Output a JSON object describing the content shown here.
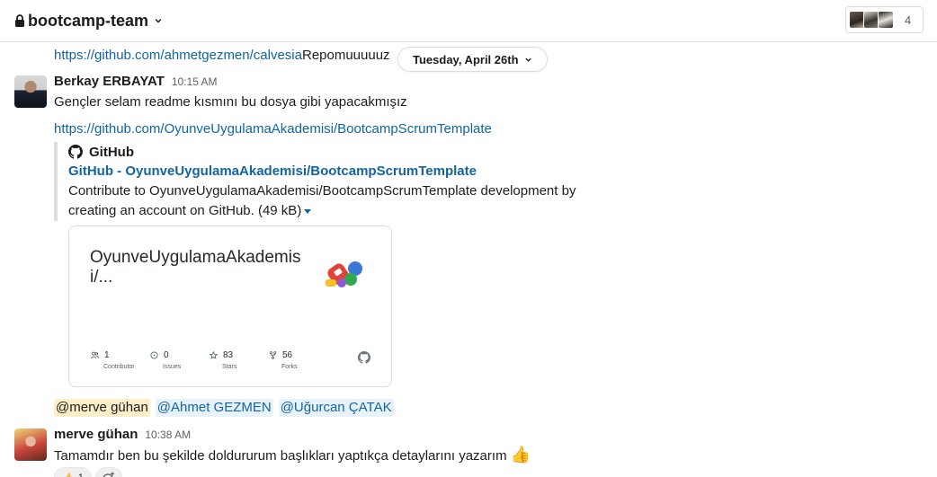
{
  "header": {
    "channel_name": "bootcamp-team",
    "member_count": "4"
  },
  "top": {
    "link": "https://github.com/ahmetgezmen/calvesia",
    "text": " Repomuuuuuz",
    "date_pill": "Tuesday, April 26th"
  },
  "message1": {
    "author": "Berkay ERBAYAT",
    "time": "10:15 AM",
    "text": "Gençler selam readme kısmını bu dosya gibi yapacakmışız",
    "link": "https://github.com/OyunveUygulamaAkademisi/BootcampScrumTemplate",
    "unfurl": {
      "source": "GitHub",
      "title": "GitHub - OyunveUygulamaAkademisi/BootcampScrumTemplate",
      "description": "Contribute to OyunveUygulamaAkademisi/BootcampScrumTemplate development by creating an account on GitHub.",
      "size": " (49 kB)"
    },
    "card": {
      "title": "OyunveUygulamaAkademisi/...",
      "stats": [
        {
          "icon": "people-icon",
          "value": "1",
          "label": "Contributor"
        },
        {
          "icon": "issue-icon",
          "value": "0",
          "label": "Issues"
        },
        {
          "icon": "star-icon",
          "value": "83",
          "label": "Stars"
        },
        {
          "icon": "fork-icon",
          "value": "56",
          "label": "Forks"
        }
      ]
    },
    "mentions": [
      "@merve gühan",
      "@Ahmet GEZMEN",
      "@Uğurcan ÇATAK"
    ]
  },
  "message2": {
    "author": "merve gühan",
    "time": "10:38 AM",
    "text": "Tamamdır ben bu şekilde doldururum başlıkları yaptıkça detaylarını yazarım",
    "emoji": "👍",
    "reactions": [
      {
        "emoji": "👍",
        "count": "1"
      }
    ]
  },
  "colors": {
    "link": "#1264a3",
    "mention_bg": "#e8f2fa",
    "self_mention_bg": "#fbeec8"
  }
}
